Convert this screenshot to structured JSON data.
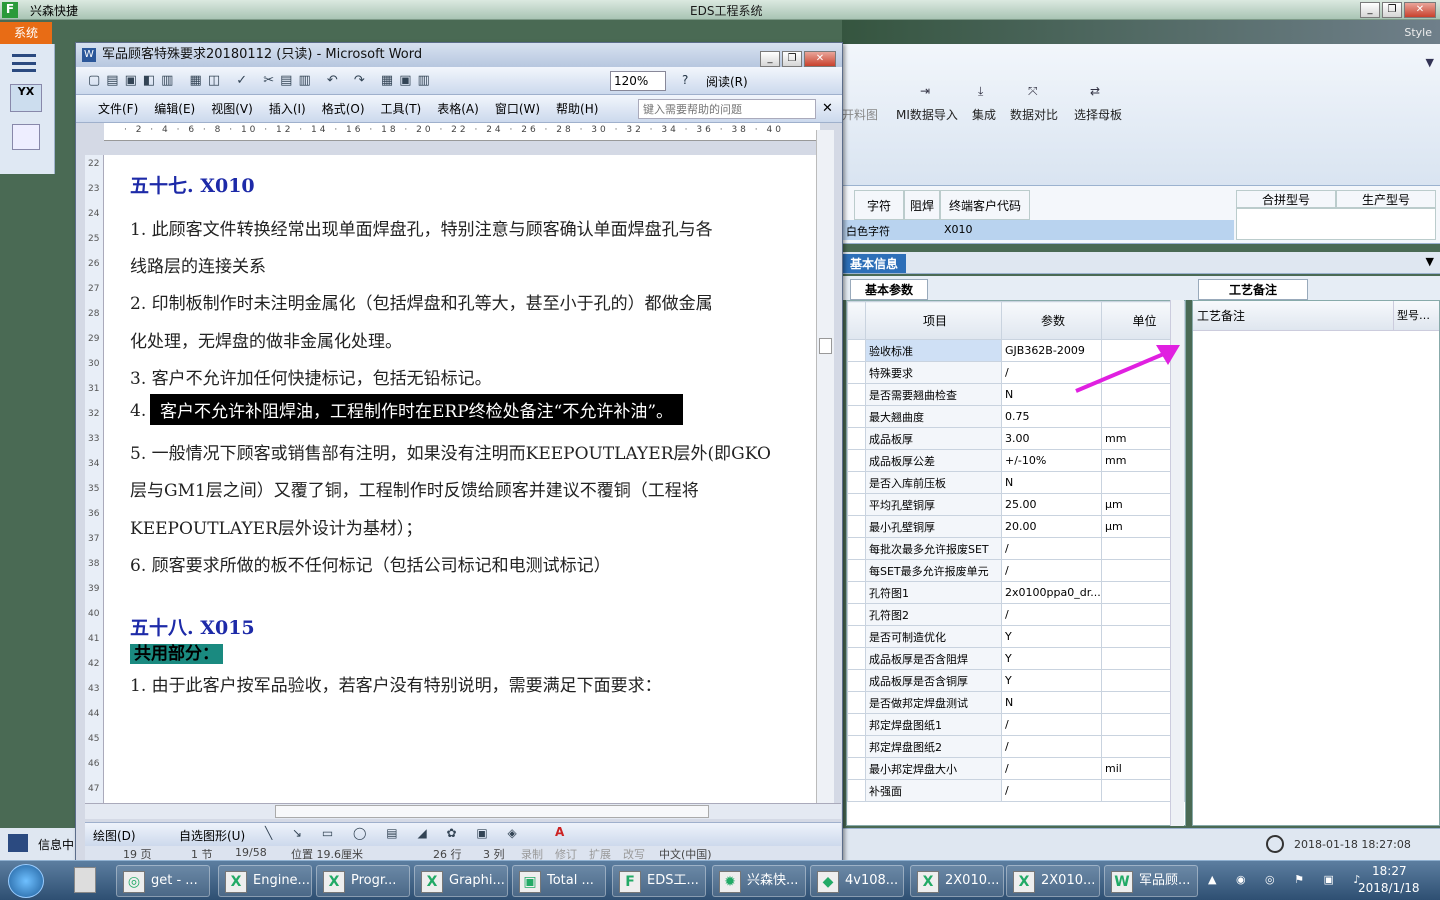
{
  "eds": {
    "title": "EDS工程系统",
    "app_name": "兴森快捷",
    "style_label": "Style",
    "system_tab": "系统",
    "ribbon_items": [
      "MI数据导入",
      "集成",
      "数据对比",
      "选择母板"
    ],
    "ribbon_partial": "开料图",
    "header_cols": [
      "字符",
      "阻焊",
      "终端客户代码",
      "合拼型号",
      "生产型号"
    ],
    "header_values": [
      "白色字符",
      "",
      "X010",
      "",
      ""
    ],
    "info_tab": "基本信息",
    "basic_tab": "基本参数",
    "craft_tab": "工艺备注",
    "craft_label": "工艺备注",
    "model_col": "型号…",
    "grid_cols": [
      "项目",
      "参数",
      "单位"
    ],
    "grid_rows": [
      [
        "验收标准",
        "GJB362B-2009",
        ""
      ],
      [
        "特殊要求",
        "/",
        ""
      ],
      [
        "是否需要翘曲检查",
        "N",
        ""
      ],
      [
        "最大翘曲度",
        "0.75",
        ""
      ],
      [
        "成品板厚",
        "3.00",
        "mm"
      ],
      [
        "成品板厚公差",
        "+/-10%",
        "mm"
      ],
      [
        "是否入库前压板",
        "N",
        ""
      ],
      [
        "平均孔壁铜厚",
        "25.00",
        "μm"
      ],
      [
        "最小孔壁铜厚",
        "20.00",
        "μm"
      ],
      [
        "每批次最多允许报废SET",
        "/",
        ""
      ],
      [
        "每SET最多允许报废单元",
        "/",
        ""
      ],
      [
        "孔符图1",
        "2x0100ppa0_dr...",
        ""
      ],
      [
        "孔符图2",
        "/",
        ""
      ],
      [
        "是否可制造优化",
        "Y",
        ""
      ],
      [
        "成品板厚是否含阻焊",
        "Y",
        ""
      ],
      [
        "成品板厚是否含铜厚",
        "Y",
        ""
      ],
      [
        "是否做邦定焊盘测试",
        "N",
        ""
      ],
      [
        "邦定焊盘图纸1",
        "/",
        ""
      ],
      [
        "邦定焊盘图纸2",
        "/",
        ""
      ],
      [
        "最小邦定焊盘大小",
        "/",
        "mil"
      ],
      [
        "补强面",
        "/",
        ""
      ]
    ],
    "datetime": "2018-01-18 18:27:08"
  },
  "word": {
    "title": "军品顾客特殊要求20180112 (只读) - Microsoft Word",
    "zoom": "120%",
    "read_btn": "阅读(R)",
    "menus": [
      "文件(F)",
      "编辑(E)",
      "视图(V)",
      "插入(I)",
      "格式(O)",
      "工具(T)",
      "表格(A)",
      "窗口(W)",
      "帮助(H)"
    ],
    "help_placeholder": "键入需要帮助的问题",
    "draw_label": "绘图(D)",
    "autoshape_label": "自选图形(U)",
    "status": [
      "19 页",
      "1 节",
      "19/58",
      "位置 19.6厘米",
      "26 行",
      "3 列",
      "录制",
      "修订",
      "扩展",
      "改写",
      "中文(中国)"
    ],
    "lines": {
      "h57": "五十七. X010",
      "p1a": "1. 此顾客文件转换经常出现单面焊盘孔，特别注意与顾客确认单面焊盘孔与各",
      "p1b": "线路层的连接关系",
      "p2a": "2. 印制板制作时未注明金属化（包括焊盘和孔等大，甚至小于孔的）都做金属",
      "p2b": "化处理，无焊盘的做非金属化处理。",
      "p3": "3. 客户不允许加任何快捷标记，包括无铅标记。",
      "p4num": "4.",
      "p4": "客户不允许补阻焊油，工程制作时在ERP终检处备注“不允许补油”。",
      "p5a": "5. 一般情况下顾客或销售部有注明，如果没有注明而KEEPOUTLAYER层外(即GKO",
      "p5b": "层与GM1层之间）又覆了铜，工程制作时反馈给顾客并建议不覆铜（工程将",
      "p5c": "KEEPOUTLAYER层外设计为基材）；",
      "p6": "6. 顾客要求所做的板不任何标记（包括公司标记和电测试标记）",
      "h58": "五十八. X015",
      "shared": "共用部分：",
      "p7": "1. 由于此客户按军品验收，若客户没有特别说明，需要满足下面要求："
    }
  },
  "taskbar": {
    "items": [
      "get - ...",
      "Engine...",
      "Progr...",
      "Graphi...",
      "Total ...",
      "EDS工...",
      "兴森快...",
      "4v108...",
      "2X010...",
      "2X010...",
      "军品顾..."
    ],
    "time": "18:27",
    "date": "2018/1/18",
    "info_label": "信息中"
  },
  "colors": {
    "arrow": "#e020e0",
    "heading": "#1d2aa8",
    "highlight_teal": "#1a8a80"
  }
}
